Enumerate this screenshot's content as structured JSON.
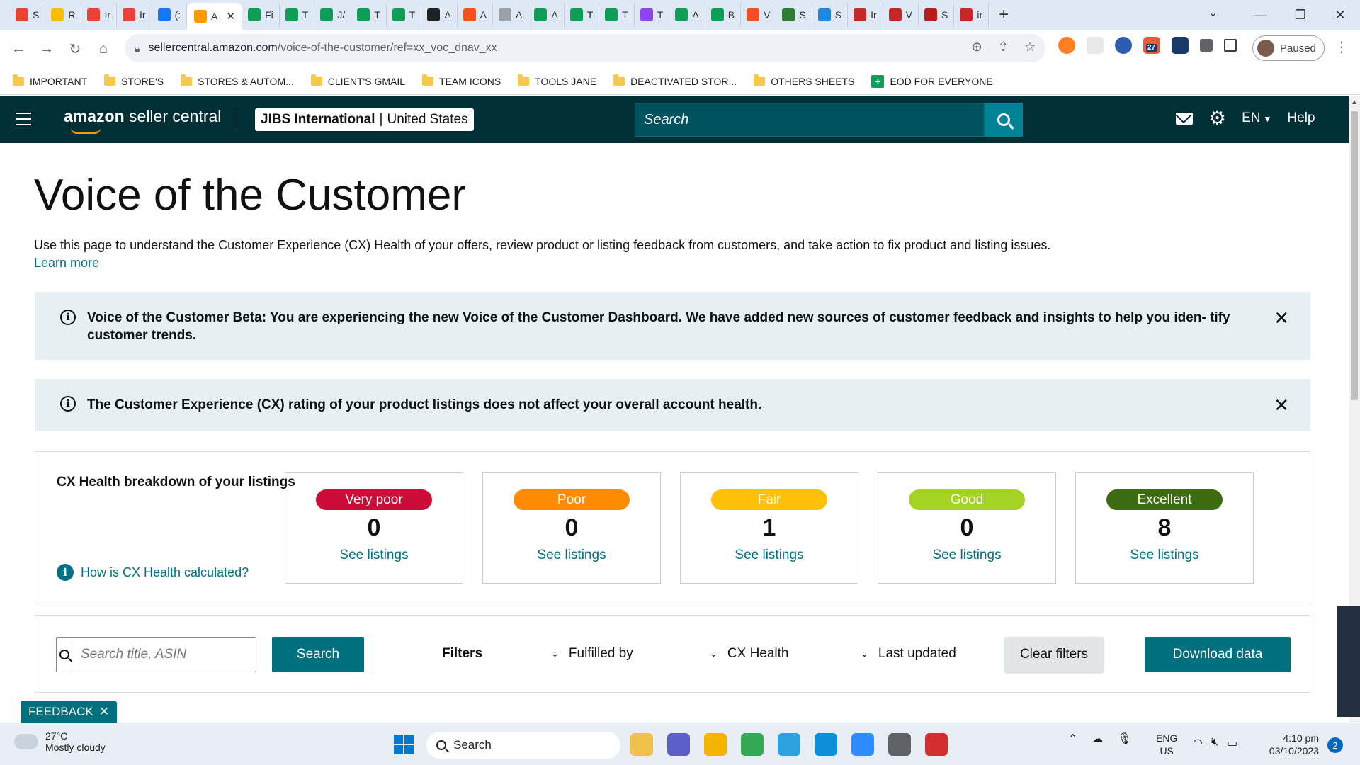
{
  "browser": {
    "tabs": [
      {
        "label": "S",
        "icon": "gmail-icon",
        "color": "#ea4335"
      },
      {
        "label": "R",
        "icon": "drive-icon",
        "color": "#fbbc04"
      },
      {
        "label": "Ir",
        "icon": "gmail-icon",
        "color": "#ea4335"
      },
      {
        "label": "Ir",
        "icon": "gmail-icon",
        "color": "#ea4335"
      },
      {
        "label": "(:",
        "icon": "facebook-icon",
        "color": "#1877f2"
      },
      {
        "label": "A",
        "icon": "amazon-icon",
        "color": "#ff9900",
        "active": true
      },
      {
        "label": "Fi",
        "icon": "sheets-icon",
        "color": "#0f9d58"
      },
      {
        "label": "T",
        "icon": "sheets-icon",
        "color": "#0f9d58"
      },
      {
        "label": "J/",
        "icon": "sheets-icon",
        "color": "#0f9d58"
      },
      {
        "label": "T",
        "icon": "sheets-icon",
        "color": "#0f9d58"
      },
      {
        "label": "T",
        "icon": "sheets-icon",
        "color": "#0f9d58"
      },
      {
        "label": "A",
        "icon": "chatgpt-icon",
        "color": "#202124"
      },
      {
        "label": "A",
        "icon": "pencil-icon",
        "color": "#f4511e"
      },
      {
        "label": "A",
        "icon": "globe-icon",
        "color": "#9aa0a6"
      },
      {
        "label": "A",
        "icon": "sheets-icon",
        "color": "#0f9d58"
      },
      {
        "label": "T",
        "icon": "sheets-icon",
        "color": "#0f9d58"
      },
      {
        "label": "T",
        "icon": "sheets-icon",
        "color": "#0f9d58"
      },
      {
        "label": "T",
        "icon": "messenger-icon",
        "color": "#8e44ef"
      },
      {
        "label": "A",
        "icon": "sheets-icon",
        "color": "#0f9d58"
      },
      {
        "label": "B",
        "icon": "sheets-icon",
        "color": "#0f9d58"
      },
      {
        "label": "V",
        "icon": "microsoft-icon",
        "color": "#f25022"
      },
      {
        "label": "S",
        "icon": "w-logo-icon",
        "color": "#2e7d32"
      },
      {
        "label": "S",
        "icon": "cloud-icon",
        "color": "#1e88e5"
      },
      {
        "label": "Ir",
        "icon": "toolsforsale-icon",
        "color": "#c62828"
      },
      {
        "label": "V",
        "icon": "ww-icon",
        "color": "#c62828"
      },
      {
        "label": "S",
        "icon": "cs-icon",
        "color": "#b71c1c"
      },
      {
        "label": "ir",
        "icon": "funnel-icon",
        "color": "#c62828"
      }
    ],
    "new_tab": "+",
    "url_domain": "sellercentral.amazon.com",
    "url_path": "/voice-of-the-customer/ref=xx_voc_dnav_xx",
    "profile_status": "Paused",
    "extension_badge": "27",
    "bookmarks": [
      {
        "label": "IMPORTANT",
        "type": "folder"
      },
      {
        "label": "STORE'S",
        "type": "folder"
      },
      {
        "label": "STORES & AUTOM...",
        "type": "folder"
      },
      {
        "label": "CLIENT'S GMAIL",
        "type": "folder"
      },
      {
        "label": "TEAM ICONS",
        "type": "folder"
      },
      {
        "label": "TOOLS JANE",
        "type": "folder"
      },
      {
        "label": "DEACTIVATED STOR...",
        "type": "folder"
      },
      {
        "label": "OTHERS SHEETS",
        "type": "folder"
      },
      {
        "label": "EOD FOR EVERYONE",
        "type": "sheet"
      }
    ]
  },
  "header": {
    "logo_bold": "amazon",
    "logo_rest": " seller central",
    "store_name": "JIBS International",
    "store_sep": "|",
    "store_region": "United States",
    "search_placeholder": "Search",
    "lang": "EN",
    "help": "Help",
    "bg_color": "#002f36"
  },
  "page": {
    "title": "Voice of the Customer",
    "description": "Use this page to understand the Customer Experience (CX) Health of your offers, review product or listing feedback from customers, and take action to fix product and listing issues.",
    "learn_more": "Learn more",
    "alerts": [
      {
        "text": "Voice of the Customer Beta: You are experiencing the new Voice of the Customer Dashboard. We have added new sources of customer feedback and insights to help you iden- tify customer trends."
      },
      {
        "text": "The Customer Experience (CX) rating of your product listings does not affect your overall account health."
      }
    ],
    "cx": {
      "title": "CX Health breakdown of your listings",
      "how_link": "How is CX Health calculated?",
      "buckets": [
        {
          "label": "Very poor",
          "count": "0",
          "link": "See listings",
          "color": "#cc0c39"
        },
        {
          "label": "Poor",
          "count": "0",
          "link": "See listings",
          "color": "#ff8c00"
        },
        {
          "label": "Fair",
          "count": "1",
          "link": "See listings",
          "color": "#ffc107"
        },
        {
          "label": "Good",
          "count": "0",
          "link": "See listings",
          "color": "#a5d323"
        },
        {
          "label": "Excellent",
          "count": "8",
          "link": "See listings",
          "color": "#3d6b0f"
        }
      ]
    },
    "filters": {
      "search_placeholder": "Search title, ASIN",
      "search_button": "Search",
      "label": "Filters",
      "dropdowns": [
        "Fulfilled by",
        "CX Health",
        "Last updated"
      ],
      "clear": "Clear filters",
      "download": "Download data"
    },
    "feedback_tab": "FEEDBACK"
  },
  "taskbar": {
    "temp": "27°C",
    "condition": "Mostly cloudy",
    "search": "Search",
    "lang_top": "ENG",
    "lang_bottom": "US",
    "time": "4:10 pm",
    "date": "03/10/2023",
    "notifications": "2",
    "apps": [
      {
        "icon": "file-explorer-icon",
        "color": "#f0c24b"
      },
      {
        "icon": "teams-icon",
        "color": "#5b5fc7"
      },
      {
        "icon": "folder-icon",
        "color": "#f5b400"
      },
      {
        "icon": "chrome-icon",
        "color": "#34a853"
      },
      {
        "icon": "telegram-icon",
        "color": "#2aa3df"
      },
      {
        "icon": "edge-icon",
        "color": "#0c8ed9"
      },
      {
        "icon": "zoom-icon",
        "color": "#2d8cff"
      },
      {
        "icon": "calculator-icon",
        "color": "#5f6368"
      },
      {
        "icon": "wps-icon",
        "color": "#d32f2f"
      }
    ]
  }
}
